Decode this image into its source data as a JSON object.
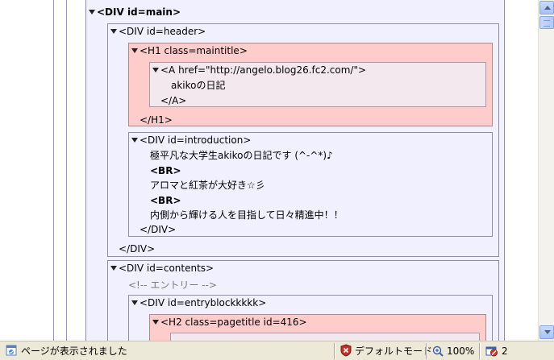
{
  "tree": {
    "div_main": "<DIV id=main>",
    "div_header": "<DIV id=header>",
    "h1_open": "<H1 class=maintitle>",
    "a_open": "<A href=\"http://angelo.blog26.fc2.com/\">",
    "a_text": "akikoの日記",
    "a_close": "</A>",
    "h1_close": "</H1>",
    "div_intro": "<DIV id=introduction>",
    "intro_line1": "極平凡な大学生akikoの日記です (^-^*)♪",
    "br1": "<BR>",
    "intro_line2": "アロマと紅茶が大好き☆彡",
    "br2": "<BR>",
    "intro_line3": "内側から輝ける人を目指して日々精進中！！",
    "div_intro_close": "</DIV>",
    "div_header_close": "</DIV>",
    "div_contents": "<DIV id=contents>",
    "comment_entry": "<!-- エントリー -->",
    "div_entryblock": "<DIV id=entryblockkkkk>",
    "h2_open": "<H2 class=pagetitle id=416>"
  },
  "status": {
    "message": "ページが表示されました",
    "mode": "デフォルトモード",
    "zoom": "100%",
    "popup_count": "2"
  },
  "icons": {
    "page": "page-done-icon",
    "shield": "shield-icon",
    "zoom": "zoom-icon",
    "popup": "popup-blocker-icon"
  }
}
